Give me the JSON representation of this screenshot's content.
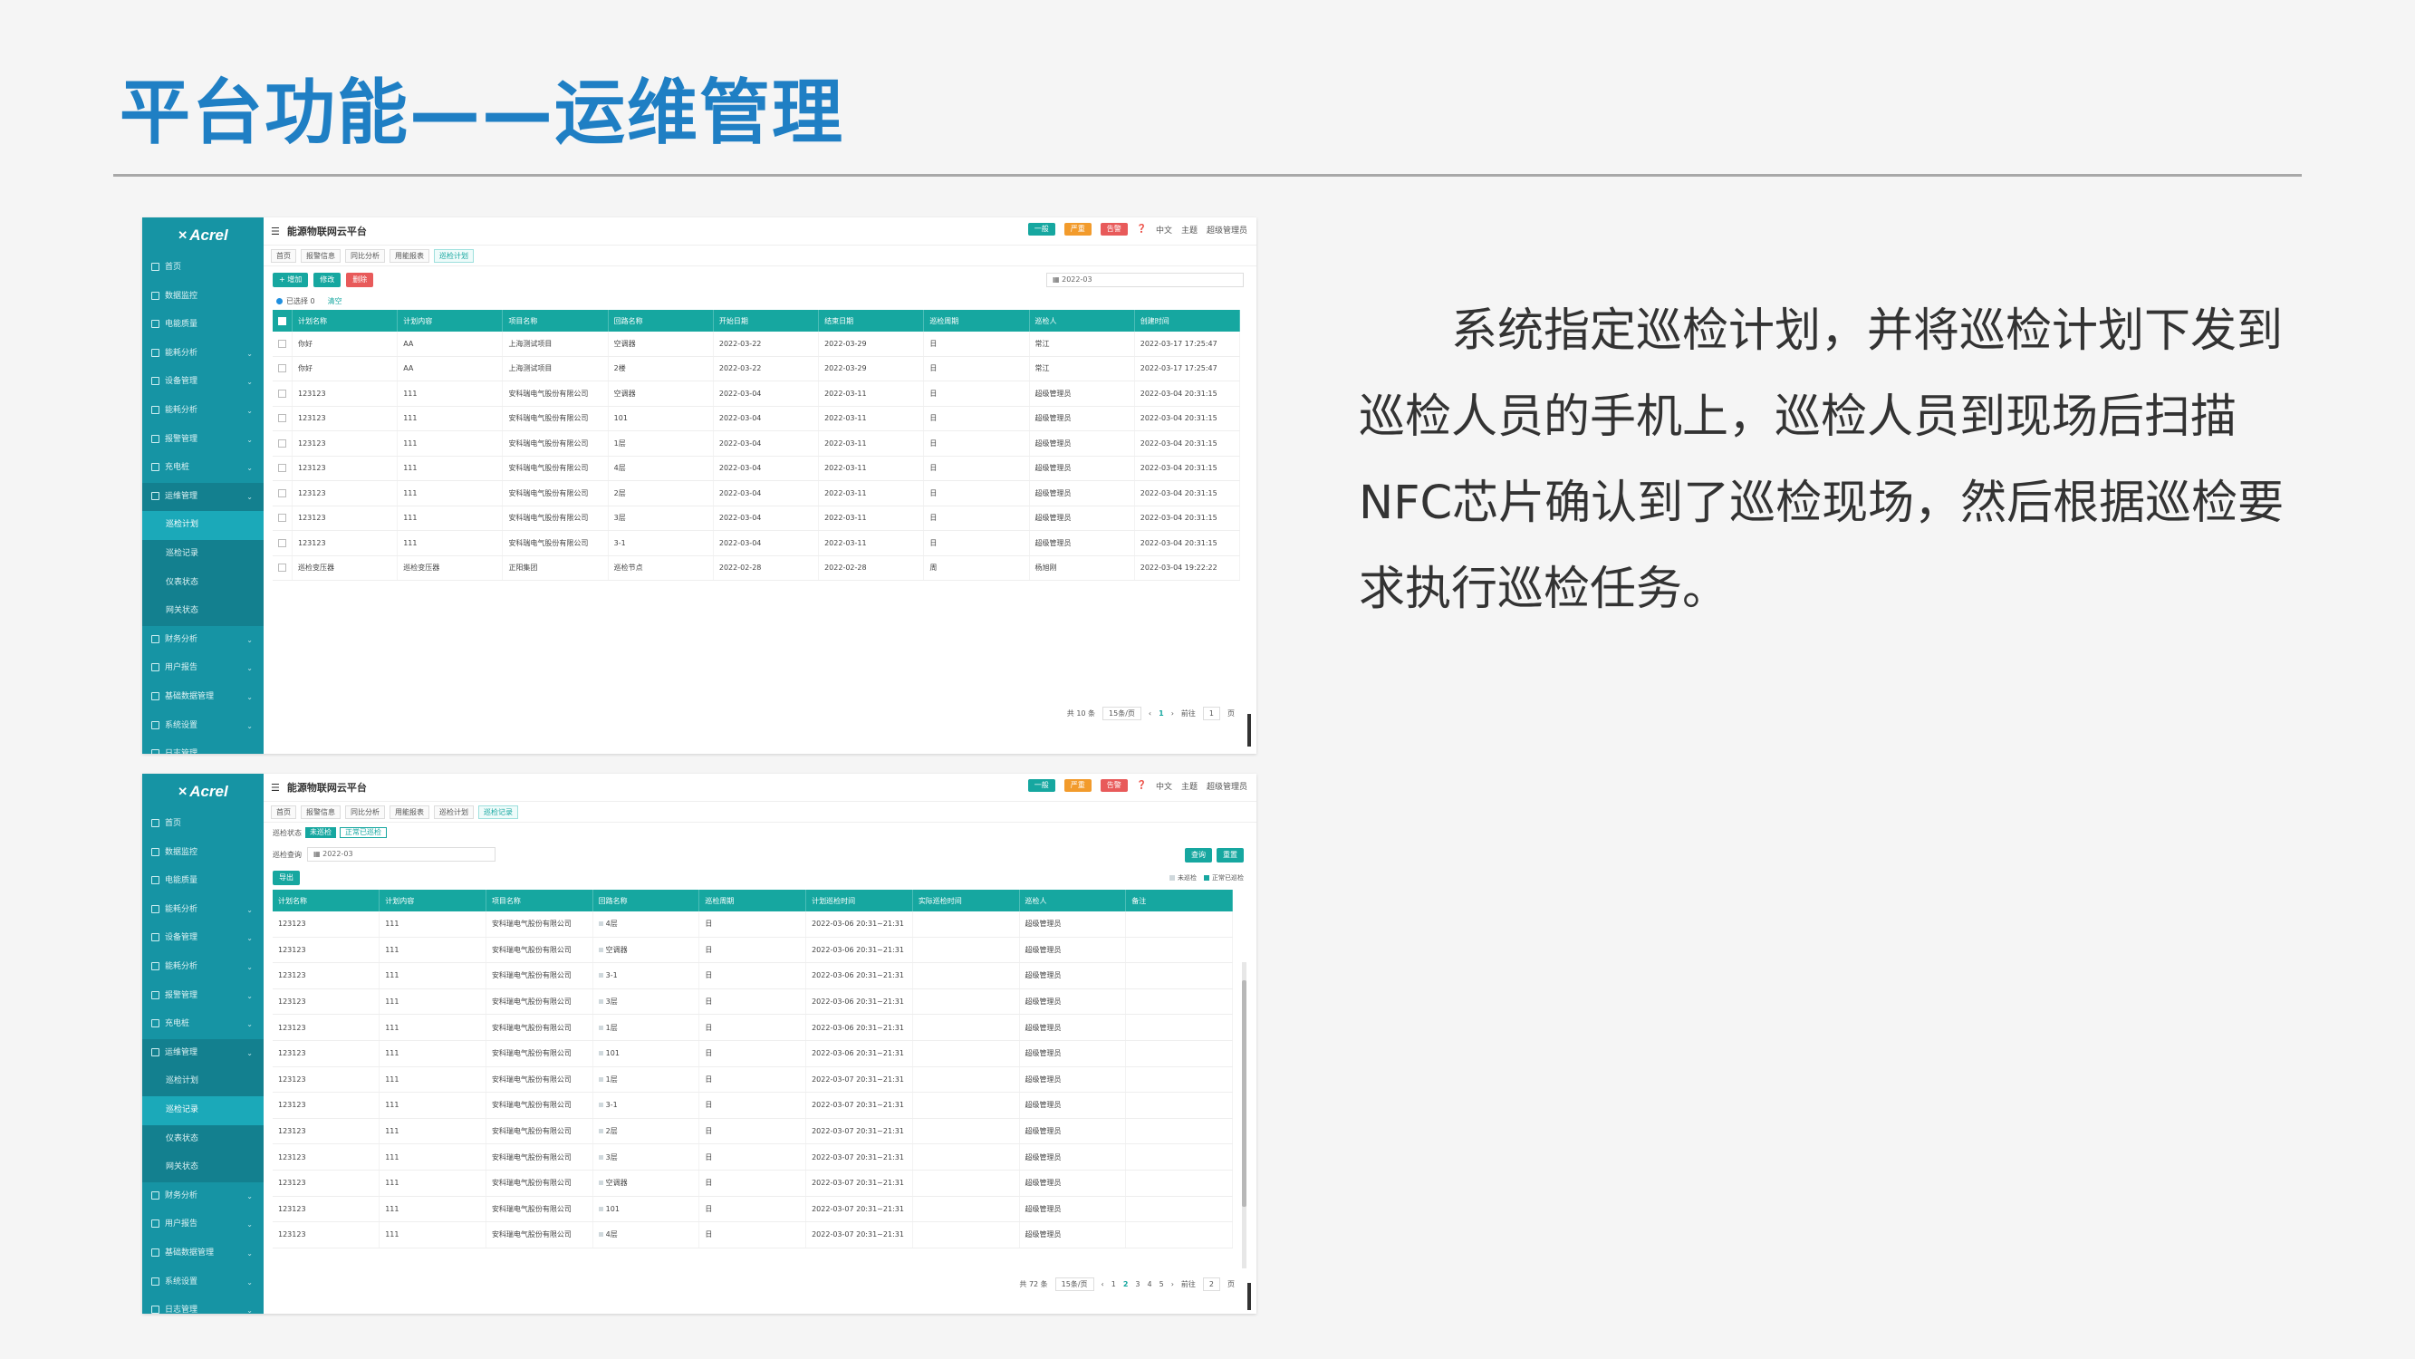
{
  "slide": {
    "title": "平台功能——运维管理",
    "description": "系统指定巡检计划，并将巡检计划下发到巡检人员的手机上，巡检人员到现场后扫描NFC芯片确认到了巡检现场，然后根据巡检要求执行巡检任务。"
  },
  "app": {
    "brand": "Acrel",
    "title": "能源物联网云平台",
    "top_pills": [
      "一般",
      "严重",
      "告警"
    ],
    "lang": "中文",
    "theme": "主题",
    "user": "超级管理员"
  },
  "sidebar": [
    {
      "label": "首页"
    },
    {
      "label": "数据监控"
    },
    {
      "label": "电能质量"
    },
    {
      "label": "能耗分析"
    },
    {
      "label": "设备管理"
    },
    {
      "label": "能耗分析"
    },
    {
      "label": "报警管理"
    },
    {
      "label": "充电桩"
    },
    {
      "label": "运维管理"
    },
    {
      "label": "巡检计划",
      "sub": true
    },
    {
      "label": "巡检记录",
      "sub": true
    },
    {
      "label": "仪表状态",
      "sub": true
    },
    {
      "label": "网关状态",
      "sub": true
    },
    {
      "label": "财务分析"
    },
    {
      "label": "用户报告"
    },
    {
      "label": "基础数据管理"
    },
    {
      "label": "系统设置"
    },
    {
      "label": "日志管理"
    }
  ],
  "screen1": {
    "tabs": [
      "首页",
      "报警信息",
      "同比分析",
      "用能报表",
      "巡检计划"
    ],
    "buttons": {
      "add": "+ 增加",
      "edit": "修改",
      "delete": "删除"
    },
    "date": "2022-03",
    "selected": "已选择 0",
    "clear": "清空",
    "columns": [
      "计划名称",
      "计划内容",
      "项目名称",
      "回路名称",
      "开始日期",
      "结束日期",
      "巡检周期",
      "巡检人",
      "创建时间"
    ],
    "rows": [
      [
        "你好",
        "AA",
        "上海测试项目",
        "空调器",
        "2022-03-22",
        "2022-03-29",
        "日",
        "常江",
        "2022-03-17 17:25:47"
      ],
      [
        "你好",
        "AA",
        "上海测试项目",
        "2楼",
        "2022-03-22",
        "2022-03-29",
        "日",
        "常江",
        "2022-03-17 17:25:47"
      ],
      [
        "123123",
        "111",
        "安科瑞电气股份有限公司",
        "空调器",
        "2022-03-04",
        "2022-03-11",
        "日",
        "超级管理员",
        "2022-03-04 20:31:15"
      ],
      [
        "123123",
        "111",
        "安科瑞电气股份有限公司",
        "101",
        "2022-03-04",
        "2022-03-11",
        "日",
        "超级管理员",
        "2022-03-04 20:31:15"
      ],
      [
        "123123",
        "111",
        "安科瑞电气股份有限公司",
        "1层",
        "2022-03-04",
        "2022-03-11",
        "日",
        "超级管理员",
        "2022-03-04 20:31:15"
      ],
      [
        "123123",
        "111",
        "安科瑞电气股份有限公司",
        "4层",
        "2022-03-04",
        "2022-03-11",
        "日",
        "超级管理员",
        "2022-03-04 20:31:15"
      ],
      [
        "123123",
        "111",
        "安科瑞电气股份有限公司",
        "2层",
        "2022-03-04",
        "2022-03-11",
        "日",
        "超级管理员",
        "2022-03-04 20:31:15"
      ],
      [
        "123123",
        "111",
        "安科瑞电气股份有限公司",
        "3层",
        "2022-03-04",
        "2022-03-11",
        "日",
        "超级管理员",
        "2022-03-04 20:31:15"
      ],
      [
        "123123",
        "111",
        "安科瑞电气股份有限公司",
        "3-1",
        "2022-03-04",
        "2022-03-11",
        "日",
        "超级管理员",
        "2022-03-04 20:31:15"
      ],
      [
        "巡检变压器",
        "巡检变压器",
        "正阳集团",
        "巡检节点",
        "2022-02-28",
        "2022-02-28",
        "周",
        "杨旭刚",
        "2022-03-04 19:22:22"
      ]
    ],
    "pager": {
      "total": "共 10 条",
      "size": "15条/页",
      "page": "1",
      "goto": "前往",
      "goto_page": "1",
      "suffix": "页"
    }
  },
  "screen2": {
    "tabs": [
      "首页",
      "报警信息",
      "同比分析",
      "用能报表",
      "巡检计划",
      "巡检记录"
    ],
    "status_label": "巡检状态",
    "status_chips": [
      "未巡检",
      "正常已巡检"
    ],
    "date_label": "巡检查询",
    "date": "2022-03",
    "query": "查询",
    "reset": "重置",
    "export": "导出",
    "legend": [
      "未巡检",
      "正常已巡检"
    ],
    "columns": [
      "计划名称",
      "计划内容",
      "项目名称",
      "回路名称",
      "巡检周期",
      "计划巡检时间",
      "实际巡检时间",
      "巡检人",
      "备注"
    ],
    "rows": [
      [
        "123123",
        "111",
        "安科瑞电气股份有限公司",
        "4层",
        "日",
        "2022-03-06 20:31~21:31",
        "",
        "超级管理员",
        ""
      ],
      [
        "123123",
        "111",
        "安科瑞电气股份有限公司",
        "空调器",
        "日",
        "2022-03-06 20:31~21:31",
        "",
        "超级管理员",
        ""
      ],
      [
        "123123",
        "111",
        "安科瑞电气股份有限公司",
        "3-1",
        "日",
        "2022-03-06 20:31~21:31",
        "",
        "超级管理员",
        ""
      ],
      [
        "123123",
        "111",
        "安科瑞电气股份有限公司",
        "3层",
        "日",
        "2022-03-06 20:31~21:31",
        "",
        "超级管理员",
        ""
      ],
      [
        "123123",
        "111",
        "安科瑞电气股份有限公司",
        "1层",
        "日",
        "2022-03-06 20:31~21:31",
        "",
        "超级管理员",
        ""
      ],
      [
        "123123",
        "111",
        "安科瑞电气股份有限公司",
        "101",
        "日",
        "2022-03-06 20:31~21:31",
        "",
        "超级管理员",
        ""
      ],
      [
        "123123",
        "111",
        "安科瑞电气股份有限公司",
        "1层",
        "日",
        "2022-03-07 20:31~21:31",
        "",
        "超级管理员",
        ""
      ],
      [
        "123123",
        "111",
        "安科瑞电气股份有限公司",
        "3-1",
        "日",
        "2022-03-07 20:31~21:31",
        "",
        "超级管理员",
        ""
      ],
      [
        "123123",
        "111",
        "安科瑞电气股份有限公司",
        "2层",
        "日",
        "2022-03-07 20:31~21:31",
        "",
        "超级管理员",
        ""
      ],
      [
        "123123",
        "111",
        "安科瑞电气股份有限公司",
        "3层",
        "日",
        "2022-03-07 20:31~21:31",
        "",
        "超级管理员",
        ""
      ],
      [
        "123123",
        "111",
        "安科瑞电气股份有限公司",
        "空调器",
        "日",
        "2022-03-07 20:31~21:31",
        "",
        "超级管理员",
        ""
      ],
      [
        "123123",
        "111",
        "安科瑞电气股份有限公司",
        "101",
        "日",
        "2022-03-07 20:31~21:31",
        "",
        "超级管理员",
        ""
      ],
      [
        "123123",
        "111",
        "安科瑞电气股份有限公司",
        "4层",
        "日",
        "2022-03-07 20:31~21:31",
        "",
        "超级管理员",
        ""
      ]
    ],
    "pager": {
      "total": "共 72 条",
      "size": "15条/页",
      "pages": [
        "1",
        "2",
        "3",
        "4",
        "5"
      ],
      "current": "2",
      "goto": "前往",
      "goto_page": "2",
      "suffix": "页"
    }
  },
  "colors": {
    "accent": "#16a7a0",
    "sidebar": "#1694a4",
    "title": "#1f7fc4",
    "danger": "#e85a5a",
    "warning": "#f29b2c"
  }
}
